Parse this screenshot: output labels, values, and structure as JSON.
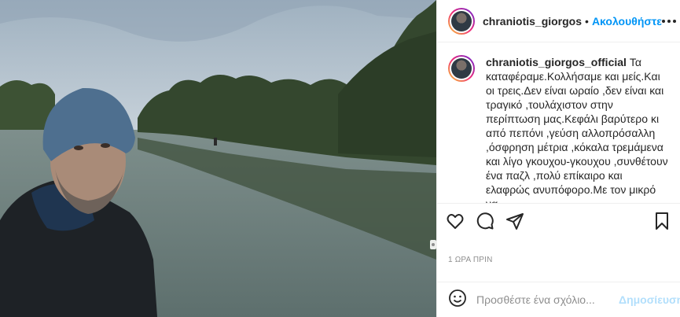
{
  "header": {
    "username": "chraniotis_giorgos",
    "separator": "•",
    "follow_label": "Ακολουθήστε"
  },
  "caption": {
    "username": "chraniotis_giorgos_official",
    "text": "Τα καταφέραμε.Κολλήσαμε και μείς.Και οι τρεις.Δεν είναι ωραίο ,δεν είναι και τραγικό ,τουλάχιστον στην περίπτωση μας.Κεφάλι βαρύτερο κι από πεπόνι ,γεύση αλλοπρόσαλλη ,όσφρηση μέτρια ,κόκαλα τρεμάμενα και λίγο γκουχου-γκουχου ,συνθέτουν ένα παζλ ,πολύ επίκαιρο και ελαφρώς ανυπόφορο.Με τον μικρό να"
  },
  "time_label": "1 ΩΡΑ ΠΡΙΝ",
  "comment": {
    "placeholder": "Προσθέστε ένα σχόλιο...",
    "post_label": "Δημοσίευση"
  },
  "icons": {
    "like": "heart-icon",
    "comment": "comment-icon",
    "share": "share-icon",
    "save": "bookmark-icon",
    "emoji": "emoji-icon",
    "more": "more-icon"
  },
  "colors": {
    "accent": "#0095f6",
    "post_disabled": "#b2dffc",
    "text": "#262626",
    "muted": "#8e8e8e"
  }
}
